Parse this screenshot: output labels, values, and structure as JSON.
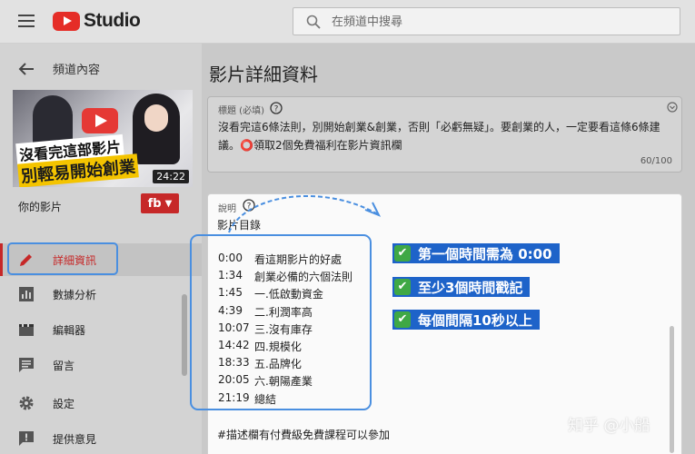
{
  "app": {
    "name": "Studio",
    "search": {
      "placeholder": "在頻道中搜尋"
    }
  },
  "sidebar": {
    "back_label": "頻道內容",
    "thumbnail": {
      "line1": "沒看完這部影片",
      "line2": "別輕易開始創業",
      "duration": "24:22"
    },
    "your_video_label": "你的影片",
    "channel_badge": "fb",
    "nav": [
      {
        "label": "詳細資訊",
        "icon": "pencil-icon",
        "active": true
      },
      {
        "label": "數據分析",
        "icon": "analytics-icon",
        "active": false
      },
      {
        "label": "編輯器",
        "icon": "editor-icon",
        "active": false
      },
      {
        "label": "留言",
        "icon": "comment-icon",
        "active": false
      },
      {
        "label": "設定",
        "icon": "gear-icon",
        "active": false
      },
      {
        "label": "提供意見",
        "icon": "feedback-icon",
        "active": false
      }
    ]
  },
  "main": {
    "page_title": "影片詳細資料",
    "title_field": {
      "label": "標題 (必填)",
      "value": "沒看完這6條法則，別開始創業&創業，否則「必虧無疑」。要創業的人，一定要看這條6條建議。⭕領取2個免費福利在影片資訊欄",
      "counter": "60/100"
    },
    "description_field": {
      "label": "說明",
      "heading": "影片目錄",
      "chapters": [
        {
          "time": "0:00",
          "title": "看這期影片的好處"
        },
        {
          "time": "1:34",
          "title": "創業必備的六個法則"
        },
        {
          "time": "1:45",
          "title": "一.低啟動資金"
        },
        {
          "time": "4:39",
          "title": "二.利潤率高"
        },
        {
          "time": "10:07",
          "title": "三.沒有庫存"
        },
        {
          "time": "14:42",
          "title": "四.規模化"
        },
        {
          "time": "18:33",
          "title": "五.品牌化"
        },
        {
          "time": "20:05",
          "title": "六.朝陽產業"
        },
        {
          "time": "21:19",
          "title": "總結"
        }
      ],
      "hashtag_line": "#描述欄有付費級免費課程可以參加"
    }
  },
  "annotations": {
    "rules": [
      "第一個時間需為 0:00",
      "至少3個時間戳記",
      "每個間隔10秒以上"
    ],
    "watermark": "知乎 @小船",
    "check_glyph": "✔",
    "highlight_color": "#4a8fe0",
    "callout_color": "#1e63c9",
    "check_color": "#3fa845"
  },
  "colors": {
    "accent": "#c62828",
    "youtube_red": "#e52d27"
  }
}
